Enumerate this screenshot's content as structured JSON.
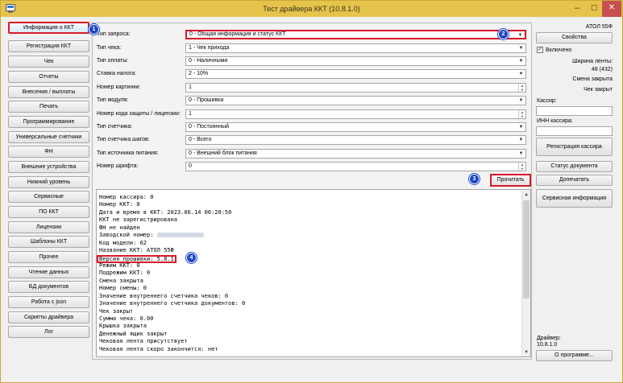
{
  "window": {
    "title": "Тест драйвера ККТ (10.8.1.0)"
  },
  "nav": [
    "Информация о ККТ",
    "Регистрация ККТ",
    "Чек",
    "Отчеты",
    "Внесения / выплаты",
    "Печать",
    "Программирование",
    "Универсальные счетчики",
    "ФН",
    "Внешние устройства",
    "Нижний уровень",
    "Сервисные",
    "ПО ККТ",
    "Лицензии",
    "Шаблоны ККТ",
    "Прочее",
    "Чтение данных",
    "БД документов",
    "Работа с json",
    "Скрипты драйвера",
    "Лог"
  ],
  "form": [
    {
      "label": "Тип запроса:",
      "value": "0 - Общая информация и статус ККТ",
      "kind": "combo"
    },
    {
      "label": "Тип чека:",
      "value": "1 - Чек прихода",
      "kind": "combo"
    },
    {
      "label": "Тип оплаты:",
      "value": "0 - Наличными",
      "kind": "combo"
    },
    {
      "label": "Ставка налога:",
      "value": "2 - 10%",
      "kind": "combo"
    },
    {
      "label": "Номер картинки:",
      "value": "1",
      "kind": "spin"
    },
    {
      "label": "Тип модуля:",
      "value": "0 - Прошивка",
      "kind": "combo"
    },
    {
      "label": "Номер кода защиты / лицензии:",
      "value": "1",
      "kind": "spin"
    },
    {
      "label": "Тип счетчика:",
      "value": "0 - Постоянный",
      "kind": "combo"
    },
    {
      "label": "Тип счетчика шагов:",
      "value": "0 - Всего",
      "kind": "combo"
    },
    {
      "label": "Тип источника питания:",
      "value": "0 - Внешний блок питания",
      "kind": "combo"
    },
    {
      "label": "Номер шрифта:",
      "value": "0",
      "kind": "spin"
    }
  ],
  "read_button": "Прочитать",
  "output": [
    "Номер кассира: 0",
    "Номер ККТ: 0",
    "Дата и время в ККТ: 2023.06.14 06:20:50",
    "ККТ не зарегистрирована",
    "ФН не найден",
    "Заводской номер:",
    "Код модели: 62",
    "Название ККТ: АТОЛ 55Ф",
    "Версия прошивки: 5.8.1",
    "Режим ККТ: 0",
    "Подрежим ККТ: 0",
    "Смена закрыта",
    "Номер смены: 0",
    "Значение внутреннего счетчика чеков: 0",
    "Значение внутреннего счетчика документов: 0",
    "Чек закрыт",
    "Сумма чека: 0.00",
    "Крышка закрыта",
    "Денежный ящик закрыт",
    "Чековая лента присутствует",
    "Чековая лента скоро закончится: нет"
  ],
  "badges": [
    "1",
    "2",
    "3",
    "4"
  ],
  "right": {
    "model": "АТОЛ 55Ф",
    "properties_button": "Свойства",
    "enabled_label": "Включено",
    "tape_width_label": "Ширина ленты:",
    "tape_width_value": "48 (432)",
    "shift_status": "Смена закрыта",
    "receipt_status": "Чек закрыт",
    "cashier_label": "Кассир:",
    "cashier_inn_label": "ИНН кассира:",
    "register_cashier_button": "Регистрация кассира",
    "document_status_button": "Статус документа",
    "reprint_button": "Допечатать",
    "service_info_button": "Сервисная информация",
    "driver_label": "Драйвер:",
    "driver_version": "10.8.1.0",
    "about_button": "О программе..."
  }
}
